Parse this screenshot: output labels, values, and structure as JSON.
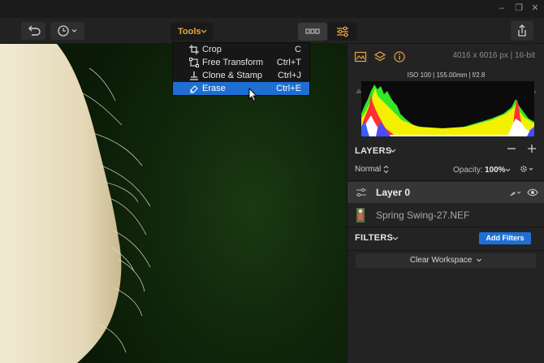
{
  "window": {
    "minimize_glyph": "–",
    "restore_glyph": "❐",
    "close_glyph": "✕"
  },
  "toolbar": {
    "tools_label": "Tools"
  },
  "tools_menu": {
    "items": [
      {
        "label": "Crop",
        "shortcut": "C",
        "icon": "crop-icon"
      },
      {
        "label": "Free Transform",
        "shortcut": "Ctrl+T",
        "icon": "free-transform-icon"
      },
      {
        "label": "Clone & Stamp",
        "shortcut": "Ctrl+J",
        "icon": "clone-stamp-icon"
      },
      {
        "label": "Erase",
        "shortcut": "Ctrl+E",
        "icon": "eraser-icon",
        "active": true
      }
    ]
  },
  "info": {
    "dimensions": "4016 x 6016 px | 16-bit",
    "exif": "ISO 100  |  155.00mm  |  f/2.8"
  },
  "layers": {
    "title": "LAYERS",
    "blend_mode": "Normal",
    "opacity_label": "Opacity:",
    "opacity_value": "100%",
    "items": [
      {
        "name": "Layer 0"
      },
      {
        "name": "Spring Swing-27.NEF"
      }
    ]
  },
  "filters": {
    "title": "FILTERS",
    "add_label": "Add Filters",
    "clear_label": "Clear Workspace"
  },
  "colors": {
    "accent_orange": "#e8a640",
    "accent_blue": "#1e70d6"
  }
}
